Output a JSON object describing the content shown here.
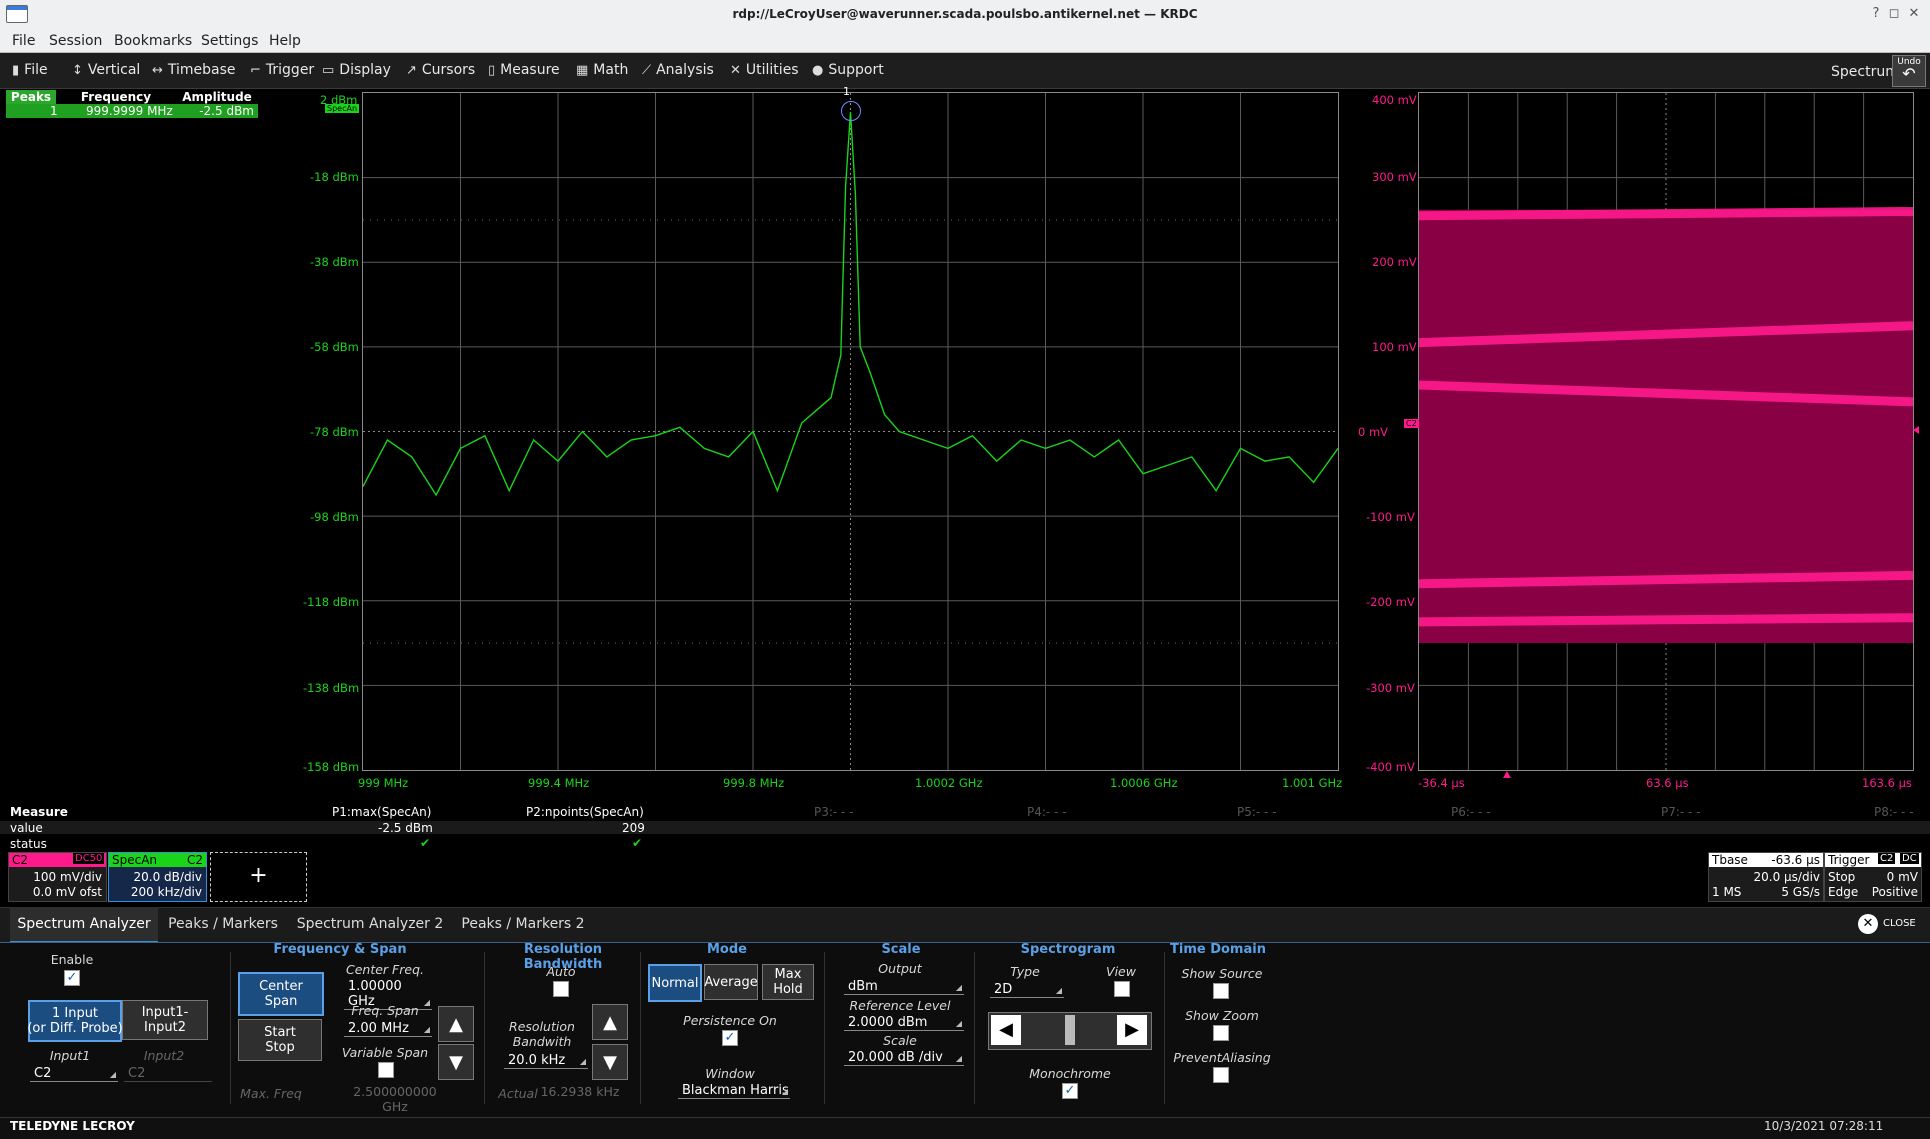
{
  "window": {
    "title": "rdp://LeCroyUser@waverunner.scada.poulsbo.antikernel.net — KRDC"
  },
  "menubar": {
    "items": [
      "File",
      "Session",
      "Bookmarks",
      "Settings",
      "Help"
    ]
  },
  "scope_menu": {
    "items": [
      {
        "label": "File",
        "icon": "file-icon",
        "glyph": "▮"
      },
      {
        "label": "Vertical",
        "icon": "vertical-icon",
        "glyph": "↕"
      },
      {
        "label": "Timebase",
        "icon": "timebase-icon",
        "glyph": "↔"
      },
      {
        "label": "Trigger",
        "icon": "trigger-icon",
        "glyph": "⌐"
      },
      {
        "label": "Display",
        "icon": "display-icon",
        "glyph": "▭"
      },
      {
        "label": "Cursors",
        "icon": "cursors-icon",
        "glyph": "↗"
      },
      {
        "label": "Measure",
        "icon": "measure-icon",
        "glyph": "▯"
      },
      {
        "label": "Math",
        "icon": "math-icon",
        "glyph": "▦"
      },
      {
        "label": "Analysis",
        "icon": "analysis-icon",
        "glyph": "⟋"
      },
      {
        "label": "Utilities",
        "icon": "utilities-icon",
        "glyph": "✕"
      },
      {
        "label": "Support",
        "icon": "support-icon",
        "glyph": "●"
      }
    ],
    "mode_label": "Spectrum",
    "undo_label": "Undo"
  },
  "peaks_table": {
    "headers": [
      "Peaks",
      "Frequency",
      "Amplitude"
    ],
    "row": {
      "index": "1",
      "frequency": "999.9999 MHz",
      "amplitude": "-2.5 dBm"
    }
  },
  "spectrum_grid": {
    "y_labels": [
      "2 dBm",
      "-18 dBm",
      "-38 dBm",
      "-58 dBm",
      "-78 dBm",
      "-98 dBm",
      "-118 dBm",
      "-138 dBm",
      "-158 dBm"
    ],
    "x_labels": [
      "999 MHz",
      "999.4 MHz",
      "999.8 MHz",
      "1.0002 GHz",
      "1.0006 GHz",
      "1.001 GHz"
    ],
    "trace_tag": "SpecAn",
    "peak_marker": "1",
    "color": "#19d419"
  },
  "chart_data": [
    {
      "type": "line",
      "series": [
        {
          "name": "SpecAn"
        }
      ],
      "x_unit": "MHz",
      "y_unit": "dBm",
      "xlim": [
        999.0,
        1001.0
      ],
      "ylim": [
        -158,
        2
      ],
      "x": [
        999.0,
        999.05,
        999.1,
        999.15,
        999.2,
        999.25,
        999.3,
        999.35,
        999.4,
        999.45,
        999.5,
        999.55,
        999.6,
        999.65,
        999.7,
        999.75,
        999.8,
        999.85,
        999.9,
        999.93,
        999.96,
        999.98,
        999.99,
        1000.0,
        1000.01,
        1000.02,
        1000.04,
        1000.07,
        1000.1,
        1000.15,
        1000.2,
        1000.25,
        1000.3,
        1000.35,
        1000.4,
        1000.45,
        1000.5,
        1000.55,
        1000.6,
        1000.65,
        1000.7,
        1000.75,
        1000.8,
        1000.85,
        1000.9,
        1000.95,
        1001.0
      ],
      "y": [
        -91,
        -80,
        -84,
        -93,
        -82,
        -79,
        -92,
        -80,
        -85,
        -78,
        -84,
        -80,
        -79,
        -77,
        -82,
        -84,
        -78,
        -92,
        -76,
        -73,
        -70,
        -60,
        -20,
        -2.5,
        -22,
        -58,
        -64,
        -74,
        -78,
        -80,
        -82,
        -79,
        -85,
        -80,
        -82,
        -80,
        -84,
        -80,
        -88,
        -86,
        -84,
        -92,
        -82,
        -85,
        -84,
        -90,
        -82
      ]
    },
    {
      "type": "area",
      "series": [
        {
          "name": "C2"
        }
      ],
      "x_unit": "µs",
      "y_unit": "mV",
      "xlim": [
        -36.4,
        163.6
      ],
      "ylim": [
        -400,
        400
      ],
      "envelope_mV": [
        262,
        -250
      ],
      "bands": [
        {
          "y_start_mV": 255,
          "y_end_mV": 260
        },
        {
          "y_start_mV": 105,
          "y_end_mV": 125
        },
        {
          "y_start_mV": 55,
          "y_end_mV": 35
        },
        {
          "y_start_mV": -180,
          "y_end_mV": -170
        },
        {
          "y_start_mV": -225,
          "y_end_mV": -220
        }
      ]
    }
  ],
  "time_grid": {
    "y_labels": [
      "400 mV",
      "300 mV",
      "200 mV",
      "100 mV",
      "0 mV",
      "-100 mV",
      "-200 mV",
      "-300 mV",
      "-400 mV"
    ],
    "x_labels": [
      "-36.4 µs",
      "63.6 µs",
      "163.6 µs"
    ],
    "channel_tag": "C2",
    "color": "#ff1a8c"
  },
  "measure": {
    "title": "Measure",
    "rows": [
      "value",
      "status"
    ],
    "params": [
      {
        "name": "P1:max(SpecAn)",
        "value": "-2.5 dBm",
        "status": "✔"
      },
      {
        "name": "P2:npoints(SpecAn)",
        "value": "209",
        "status": "✔"
      },
      {
        "name": "P3:- - -"
      },
      {
        "name": "P4:- - -"
      },
      {
        "name": "P5:- - -"
      },
      {
        "name": "P6:- - -"
      },
      {
        "name": "P7:- - -"
      },
      {
        "name": "P8:- - -"
      }
    ]
  },
  "descriptors": {
    "c2": {
      "name": "C2",
      "coupling": "DC50",
      "vdiv": "100 mV/div",
      "offset": "0.0 mV ofst"
    },
    "specan": {
      "name": "SpecAn",
      "src": "C2",
      "vdiv": "20.0 dB/div",
      "hdiv": "200 kHz/div"
    },
    "add": "+",
    "tbase": {
      "label": "Tbase",
      "value": "-63.6 µs",
      "rate": "20.0 µs/div",
      "samples": "1 MS",
      "srate": "5 GS/s"
    },
    "trigger": {
      "label": "Trigger",
      "ch": "C2",
      "coupling": "DC",
      "mode": "Stop",
      "level": "0 mV",
      "type": "Edge",
      "slope": "Positive"
    }
  },
  "dialog": {
    "tabs": [
      "Spectrum Analyzer",
      "Peaks / Markers",
      "Spectrum Analyzer 2",
      "Peaks / Markers 2"
    ],
    "close_label": "CLOSE",
    "enable_label": "Enable",
    "input_buttons": [
      "1 Input\n(or Diff. Probe)",
      "Input1-Input2"
    ],
    "input1_label": "Input1",
    "input1_value": "C2",
    "input2_label": "Input2",
    "input2_value": "C2",
    "freq_span": {
      "title": "Frequency & Span",
      "center_span_btn": "Center\nSpan",
      "start_stop_btn": "Start\nStop",
      "center_freq_label": "Center Freq.",
      "center_freq": "1.00000 GHz",
      "freq_span_label": "Freq. Span",
      "freq_span": "2.00 MHz",
      "variable_span_label": "Variable Span",
      "max_freq_label": "Max. Freq",
      "max_freq": "2.500000000 GHz"
    },
    "rbw": {
      "title": "Resolution Bandwidth",
      "auto_label": "Auto",
      "rbw_label": "Resolution\nBandwith",
      "rbw_value": "20.0 kHz",
      "actual_label": "Actual",
      "actual_value": "16.2938 kHz"
    },
    "mode": {
      "title": "Mode",
      "buttons": [
        "Normal",
        "Average",
        "Max\nHold"
      ],
      "persistence_label": "Persistence On",
      "window_label": "Window",
      "window_value": "Blackman Harris"
    },
    "scale": {
      "title": "Scale",
      "output_label": "Output",
      "output_value": "dBm",
      "ref_label": "Reference Level",
      "ref_value": "2.0000 dBm",
      "scale_label": "Scale",
      "scale_value": "20.000 dB /div"
    },
    "spectrogram": {
      "title": "Spectrogram",
      "type_label": "Type",
      "type_value": "2D",
      "view_label": "View",
      "monochrome_label": "Monochrome"
    },
    "time_domain": {
      "title": "Time Domain",
      "show_source": "Show Source",
      "show_zoom": "Show Zoom",
      "prevent_aliasing": "PreventAliasing"
    }
  },
  "footer": {
    "brand": "TELEDYNE LECROY",
    "datetime": "10/3/2021 07:28:11"
  }
}
